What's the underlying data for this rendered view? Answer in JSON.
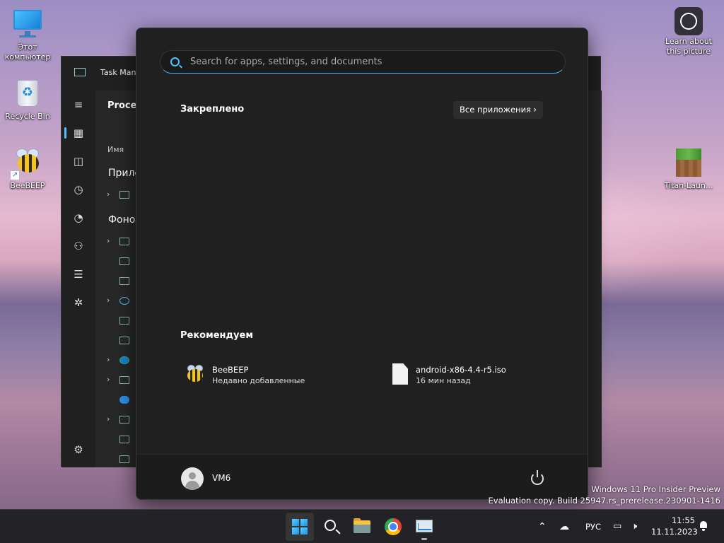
{
  "desktop": {
    "icons": [
      {
        "label": "Этот компьютер"
      },
      {
        "label": "Recycle Bin"
      },
      {
        "label": "BeeBEEP"
      },
      {
        "label": "Learn about this picture"
      },
      {
        "label": "Titan-Laun..."
      }
    ]
  },
  "taskmanager": {
    "title": "Task Manager",
    "heading": "Processes",
    "column_name": "Имя",
    "group_apps": "Прило",
    "group_background": "Фоно"
  },
  "start_menu": {
    "search": {
      "placeholder": "Search for apps, settings, and documents"
    },
    "pinned_title": "Закреплено",
    "all_apps_label": "Все приложения",
    "recommended_title": "Рекомендуем",
    "recommended": [
      {
        "title": "BeeBEEP",
        "subtitle": "Недавно добавленные",
        "icon": "beebeep-icon"
      },
      {
        "title": "android-x86-4.4-r5.iso",
        "subtitle": "16 мин назад",
        "icon": "file-icon"
      }
    ],
    "user": {
      "name": "VM6"
    }
  },
  "watermark": {
    "line1": "Windows 11 Pro Insider Preview",
    "line2": "Evaluation copy. Build 25947.rs_prerelease.230901-1416"
  },
  "taskbar": {
    "language": "РУС",
    "time": "11:55",
    "date": "11.11.2023"
  },
  "colors": {
    "accent": "#4cc2ff"
  }
}
